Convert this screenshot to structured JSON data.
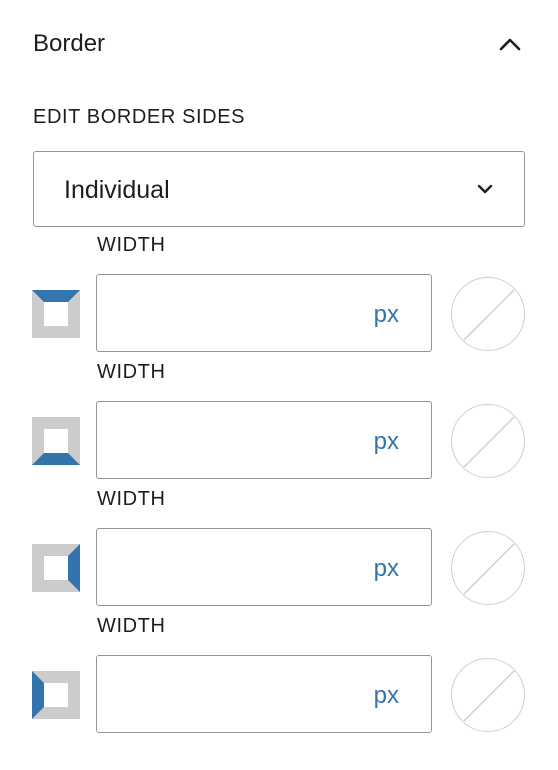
{
  "panel": {
    "title": "Border",
    "collapse_icon": "chevron-up-icon"
  },
  "edit_sides": {
    "label": "EDIT BORDER SIDES",
    "selected": "Individual",
    "dropdown_icon": "chevron-down-icon"
  },
  "sides": [
    {
      "side": "top",
      "label": "WIDTH",
      "value": "",
      "unit": "px"
    },
    {
      "side": "bottom",
      "label": "WIDTH",
      "value": "",
      "unit": "px"
    },
    {
      "side": "right",
      "label": "WIDTH",
      "value": "",
      "unit": "px"
    },
    {
      "side": "left",
      "label": "WIDTH",
      "value": "",
      "unit": "px"
    }
  ],
  "colors": {
    "accent": "#3474ad",
    "icon_gray": "#cccccc",
    "border": "#949494"
  }
}
